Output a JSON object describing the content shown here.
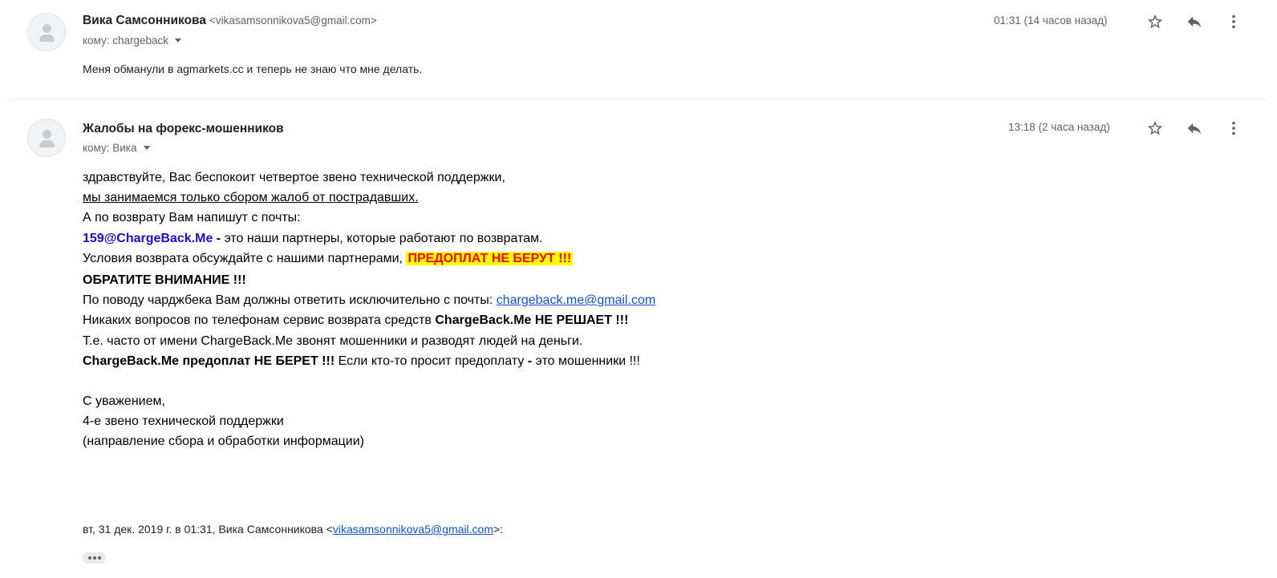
{
  "messages": [
    {
      "sender_name": "Вика Самсонникова",
      "sender_email": "<vikasamsonnikova5@gmail.com>",
      "recipient": "кому: chargeback",
      "time": "01:31 (14 часов назад)",
      "snippet": "Меня обманули в agmarkets.cc и теперь не знаю что мне делать."
    },
    {
      "sender_name": "Жалобы на форекс-мошенников",
      "recipient": "кому: Вика",
      "time": "13:18 (2 часа назад)",
      "body": {
        "l1": "здравствуйте, Вас беспокоит четвертое звено технической поддержки,",
        "l2": "мы занимаемся только сбором жалоб от пострадавших.",
        "l3": "А по возврату Вам напишут с почты:",
        "l4_email": "159@ChargeBack.Me",
        "l4_dash": " - ",
        "l4_rest": "это наши партнеры, которые работают по возвратам.",
        "l5_text": "Условия возврата обсуждайте с нашими партнерами, ",
        "l5_highlight": "ПРЕДОПЛАТ НЕ БЕРУТ !!!",
        "l6": "ОБРАТИТЕ ВНИМАНИЕ !!!",
        "l7_text": "По поводу чарджбека Вам должны ответить исключительно с почты: ",
        "l7_link": "chargeback.me@gmail.com",
        "l8_text": "Никаких вопросов по телефонам сервис возврата средств ",
        "l8_bold": "ChargeBack.Me НЕ РЕШАЕТ !!!",
        "l9": "Т.е. часто от имени ChargeBack.Me звонят мошенники и разводят людей на деньги.",
        "l10_bold": "ChargeBack.Me предоплат НЕ БЕРЕТ !!!",
        "l10_text": " Если кто-то просит предоплату ",
        "l10_dash": "-",
        "l10_rest": " это мошенники !!!",
        "sig1": "С уважением,",
        "sig2": "4-е звено технической поддержки",
        "sig3": "(направление сбора и обработки информации)"
      },
      "quote_prefix": "вт, 31 дек. 2019 г. в 01:31, Вика Самсонникова <",
      "quote_email": "vikasamsonnikova5@gmail.com",
      "quote_suffix": ">:"
    }
  ],
  "icons": {
    "star": "star-icon",
    "reply": "reply-icon",
    "more": "more-vertical-icon",
    "avatar": "person-icon",
    "expand": "show-trimmed-content-icon"
  },
  "colors": {
    "highlight_bg": "#ffff00",
    "highlight_text": "#ff0000",
    "link": "#1155cc",
    "partner_email": "#1a0dcc"
  }
}
